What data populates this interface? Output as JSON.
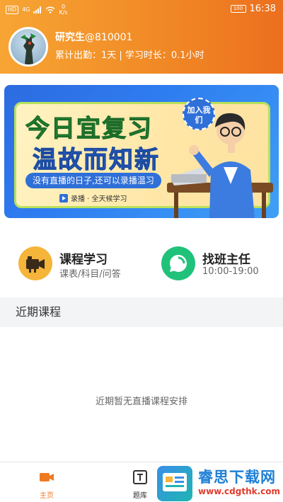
{
  "status_bar": {
    "network_badge": "HD",
    "signal_label": "4G",
    "speed_value": "0",
    "speed_unit": "K/s",
    "battery": "100",
    "time": "16:38"
  },
  "profile": {
    "name": "研究生",
    "user_id": "@810001",
    "stats": "累计出勤：1天 | 学习时长：0.1小时"
  },
  "banner": {
    "title_line1": "今日宜复习",
    "title_line2": "温故而知新",
    "pill_text": "没有直播的日子,还可以录播温习",
    "footer_text": "录播 · 全天候学习",
    "stamp_text": "加入我们"
  },
  "quick_actions": [
    {
      "title": "课程学习",
      "subtitle": "课表/科目/问答",
      "icon": "video-camera-icon",
      "color": "#f5b43a"
    },
    {
      "title": "找班主任",
      "subtitle": "10:00-19:00",
      "icon": "chat-bubble-icon",
      "color": "#20c27a"
    }
  ],
  "section": {
    "title": "近期课程",
    "empty_message": "近期暂无直播课程安排"
  },
  "bottom_nav": [
    {
      "label": "主页",
      "icon": "video-icon",
      "active": true,
      "color": "#f07a22"
    },
    {
      "label": "题库",
      "icon": "text-box-icon",
      "active": false,
      "color": "#333333"
    }
  ],
  "watermark": {
    "title": "睿思下载网",
    "url": "www.cdgthk.com"
  },
  "colors": {
    "header_start": "#f7a534",
    "header_end": "#ec6f1e",
    "accent": "#f07a22"
  }
}
